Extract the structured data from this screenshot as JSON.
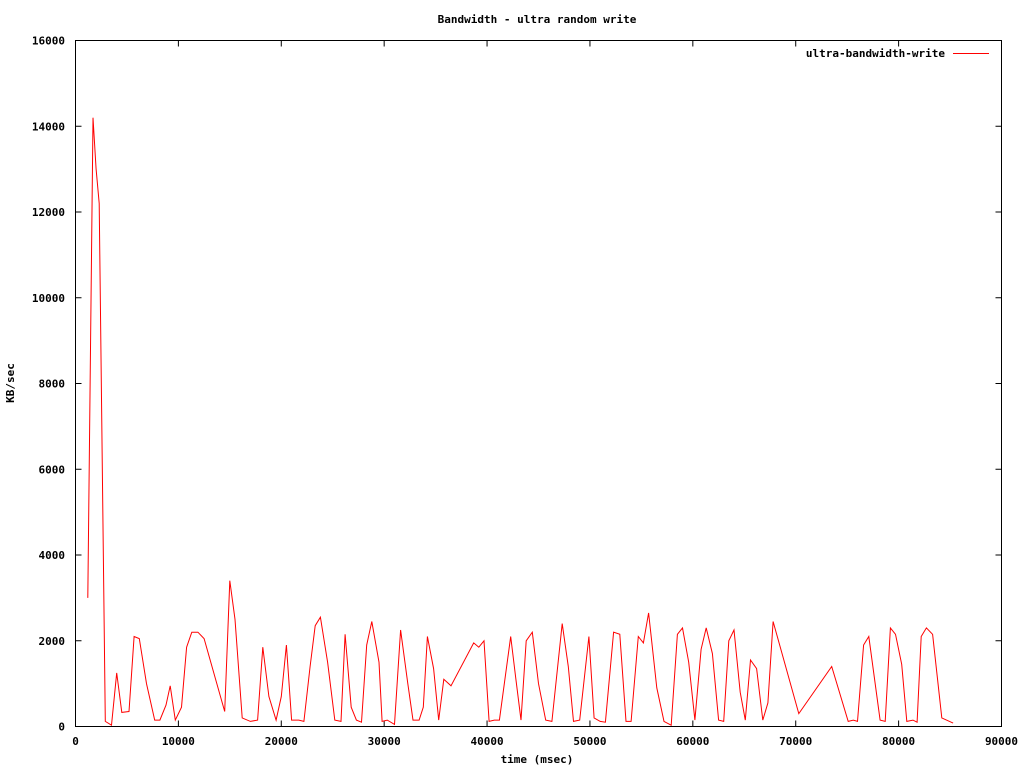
{
  "chart_data": {
    "type": "line",
    "title": "Bandwidth - ultra random write",
    "xlabel": "time (msec)",
    "ylabel": "KB/sec",
    "xlim": [
      0,
      90000
    ],
    "ylim": [
      0,
      16000
    ],
    "xticks": [
      0,
      10000,
      20000,
      30000,
      40000,
      50000,
      60000,
      70000,
      80000,
      90000
    ],
    "yticks": [
      0,
      2000,
      4000,
      6000,
      8000,
      10000,
      12000,
      14000,
      16000
    ],
    "grid": false,
    "legend_position": "top-right",
    "series": [
      {
        "name": "ultra-bandwidth-write",
        "color": "#ff0000",
        "points": [
          [
            1200,
            3000
          ],
          [
            1700,
            14200
          ],
          [
            2000,
            13000
          ],
          [
            2300,
            12200
          ],
          [
            2900,
            120
          ],
          [
            3500,
            30
          ],
          [
            4000,
            1250
          ],
          [
            4500,
            330
          ],
          [
            5200,
            350
          ],
          [
            5700,
            2100
          ],
          [
            6200,
            2050
          ],
          [
            6900,
            1000
          ],
          [
            7700,
            150
          ],
          [
            8200,
            150
          ],
          [
            8800,
            500
          ],
          [
            9200,
            950
          ],
          [
            9700,
            150
          ],
          [
            10300,
            450
          ],
          [
            10800,
            1850
          ],
          [
            11300,
            2200
          ],
          [
            11900,
            2200
          ],
          [
            12500,
            2050
          ],
          [
            14500,
            350
          ],
          [
            15000,
            3400
          ],
          [
            15500,
            2500
          ],
          [
            16200,
            200
          ],
          [
            17000,
            120
          ],
          [
            17700,
            150
          ],
          [
            18200,
            1850
          ],
          [
            18800,
            700
          ],
          [
            19500,
            150
          ],
          [
            20000,
            700
          ],
          [
            20500,
            1900
          ],
          [
            21000,
            150
          ],
          [
            21700,
            150
          ],
          [
            22200,
            120
          ],
          [
            22800,
            1400
          ],
          [
            23300,
            2350
          ],
          [
            23800,
            2550
          ],
          [
            24500,
            1500
          ],
          [
            25200,
            150
          ],
          [
            25800,
            120
          ],
          [
            26200,
            2150
          ],
          [
            26800,
            450
          ],
          [
            27300,
            150
          ],
          [
            27800,
            100
          ],
          [
            28300,
            1900
          ],
          [
            28800,
            2450
          ],
          [
            29500,
            1500
          ],
          [
            29800,
            120
          ],
          [
            30300,
            150
          ],
          [
            31000,
            50
          ],
          [
            31600,
            2250
          ],
          [
            32300,
            1000
          ],
          [
            32800,
            150
          ],
          [
            33400,
            150
          ],
          [
            33800,
            450
          ],
          [
            34200,
            2100
          ],
          [
            34800,
            1350
          ],
          [
            35300,
            150
          ],
          [
            35800,
            1100
          ],
          [
            36500,
            950
          ],
          [
            38700,
            1950
          ],
          [
            39200,
            1850
          ],
          [
            39700,
            2000
          ],
          [
            40200,
            120
          ],
          [
            40700,
            150
          ],
          [
            41200,
            150
          ],
          [
            42300,
            2100
          ],
          [
            42800,
            1100
          ],
          [
            43300,
            150
          ],
          [
            43800,
            2000
          ],
          [
            44400,
            2200
          ],
          [
            45000,
            1000
          ],
          [
            45700,
            150
          ],
          [
            46300,
            120
          ],
          [
            47300,
            2400
          ],
          [
            47900,
            1400
          ],
          [
            48400,
            120
          ],
          [
            49000,
            150
          ],
          [
            49900,
            2100
          ],
          [
            50400,
            200
          ],
          [
            51000,
            120
          ],
          [
            51500,
            100
          ],
          [
            52300,
            2200
          ],
          [
            52900,
            2150
          ],
          [
            53500,
            120
          ],
          [
            54000,
            120
          ],
          [
            54700,
            2100
          ],
          [
            55200,
            1950
          ],
          [
            55700,
            2650
          ],
          [
            56500,
            900
          ],
          [
            57200,
            120
          ],
          [
            57900,
            30
          ],
          [
            58500,
            2150
          ],
          [
            59000,
            2300
          ],
          [
            59600,
            1500
          ],
          [
            60200,
            150
          ],
          [
            60800,
            1800
          ],
          [
            61300,
            2300
          ],
          [
            61900,
            1700
          ],
          [
            62500,
            150
          ],
          [
            63000,
            120
          ],
          [
            63500,
            2000
          ],
          [
            64000,
            2250
          ],
          [
            64600,
            800
          ],
          [
            65100,
            150
          ],
          [
            65600,
            1550
          ],
          [
            66200,
            1350
          ],
          [
            66800,
            150
          ],
          [
            67300,
            550
          ],
          [
            67800,
            2450
          ],
          [
            70300,
            300
          ],
          [
            73500,
            1400
          ],
          [
            75100,
            120
          ],
          [
            75600,
            150
          ],
          [
            76000,
            120
          ],
          [
            76600,
            1900
          ],
          [
            77100,
            2100
          ],
          [
            78200,
            150
          ],
          [
            78700,
            120
          ],
          [
            79200,
            2300
          ],
          [
            79700,
            2150
          ],
          [
            80300,
            1450
          ],
          [
            80800,
            120
          ],
          [
            81400,
            150
          ],
          [
            81800,
            100
          ],
          [
            82200,
            2100
          ],
          [
            82700,
            2300
          ],
          [
            83300,
            2150
          ],
          [
            84200,
            200
          ],
          [
            85300,
            80
          ]
        ]
      }
    ]
  }
}
